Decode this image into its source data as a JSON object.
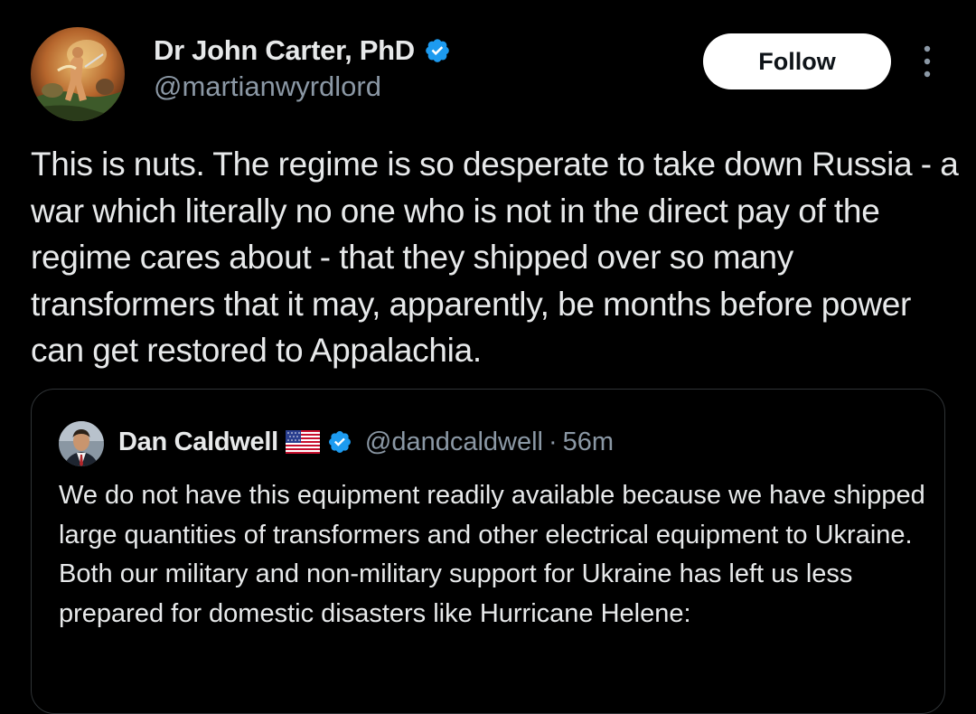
{
  "post": {
    "author": {
      "display_name": "Dr John Carter, PhD",
      "handle": "@martianwyrdlord",
      "verified": true,
      "avatar": "fantasy-painting-avatar"
    },
    "follow_label": "Follow",
    "more_icon": "more-vertical-icon",
    "text": "This is nuts. The regime is so desperate to take down Russia - a war which literally no one who is not in the direct pay of the regime cares about - that they shipped over so many transformers that it may, apparently, be months before power can get restored to Appalachia."
  },
  "quote": {
    "author": {
      "display_name": "Dan Caldwell",
      "flag": "us-flag-icon",
      "verified": true,
      "handle": "@dandcaldwell",
      "separator": "·",
      "time": "56m",
      "avatar": "man-in-suit-avatar"
    },
    "text": "We do not have this equipment readily available because we have shipped large quantities of transformers and other electrical equipment to Ukraine. Both our military and non-military support for Ukraine has left us less prepared for domestic disasters like Hurricane Helene:"
  },
  "colors": {
    "background": "#000000",
    "text_primary": "#e7e9ea",
    "text_secondary": "#8b98a5",
    "verified_blue": "#1d9bf0",
    "border": "#2f3336",
    "button_bg": "#ffffff"
  }
}
